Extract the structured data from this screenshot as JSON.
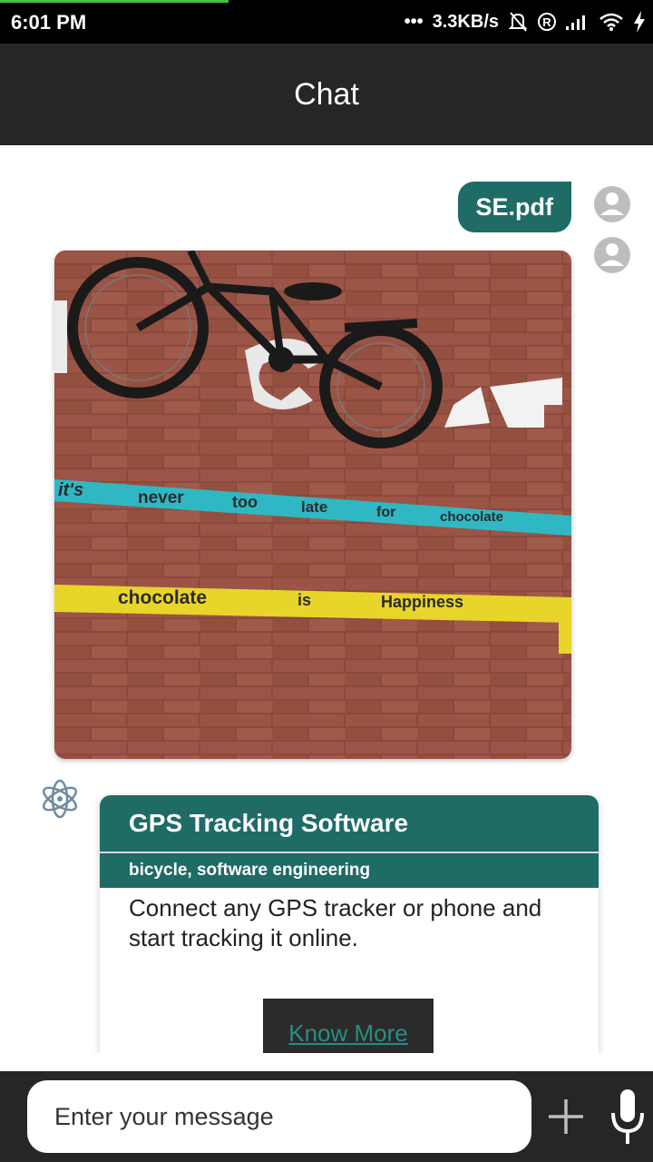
{
  "status_bar": {
    "time": "6:01 PM",
    "net_speed": "3.3KB/s",
    "icons": [
      "dots-icon",
      "mute-bell-icon",
      "registered-icon",
      "signal-icon",
      "wifi-icon",
      "charging-bolt-icon"
    ]
  },
  "header": {
    "title": "Chat"
  },
  "messages": {
    "file": {
      "name": "SE.pdf"
    },
    "image": {
      "description_icon": "photo-icon",
      "wall_texts": [
        "it's",
        "never",
        "too",
        "late",
        "for",
        "chocolate",
        "chocolate",
        "is",
        "Happiness"
      ]
    },
    "card": {
      "title": "GPS Tracking Software",
      "subtitle": "bicycle, software engineering",
      "body": "Connect any GPS tracker or phone and start tracking it online.",
      "button_label": "Know More"
    }
  },
  "input": {
    "placeholder": "Enter your message"
  },
  "colors": {
    "accent": "#1f6b66",
    "app_bar": "#262626",
    "link": "#2a8c84"
  }
}
